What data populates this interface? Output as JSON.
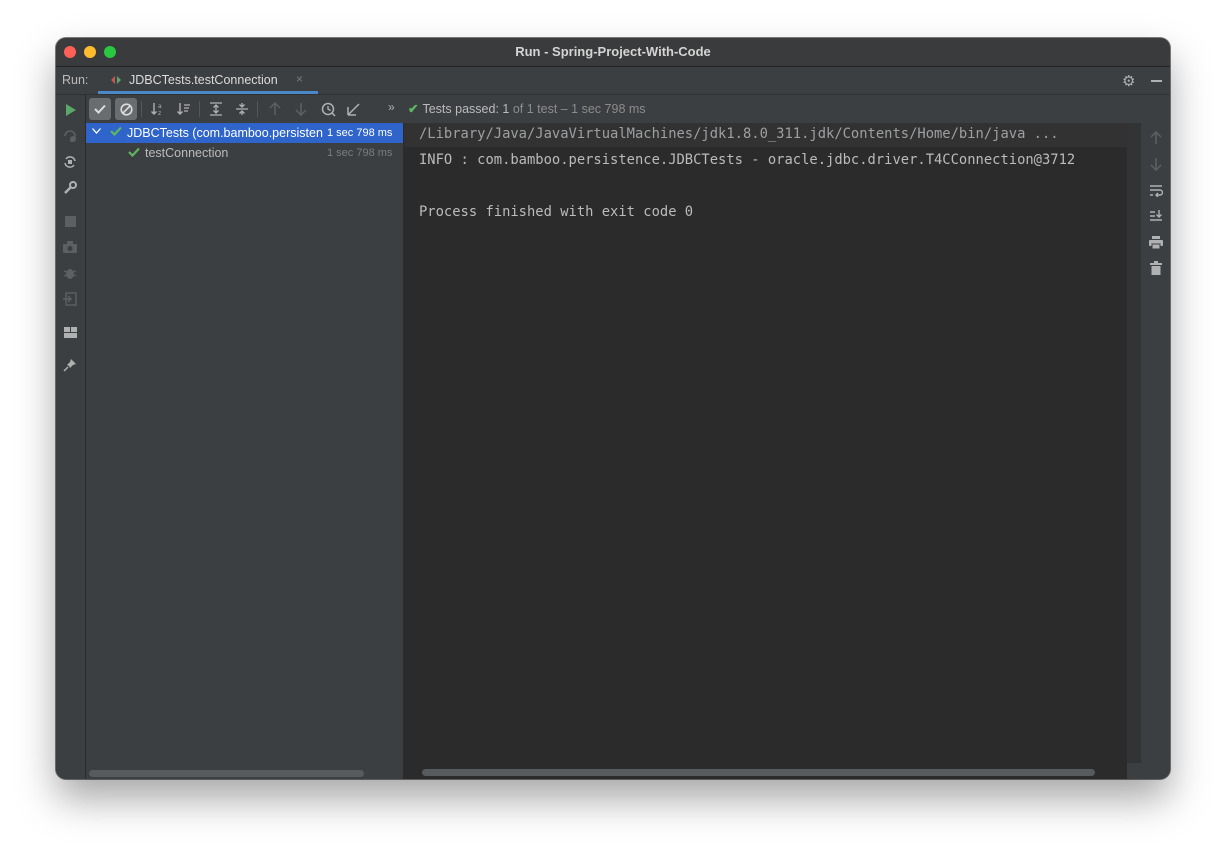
{
  "window": {
    "title": "Run - Spring-Project-With-Code"
  },
  "tabbar": {
    "run_label": "Run:",
    "tab_label": "JDBCTests.testConnection",
    "close_glyph": "×"
  },
  "toolbar": {
    "status_check": "✔",
    "status_prefix": "Tests passed: ",
    "status_count": "1",
    "status_suffix": " of 1 test – 1 sec 798 ms",
    "more_glyph": "»"
  },
  "tree": {
    "items": [
      {
        "name": "JDBCTests (com.bamboo.persistence)",
        "time": "1 sec 798 ms",
        "status": "passed",
        "selected": true
      },
      {
        "name": "testConnection",
        "time": "1 sec 798 ms",
        "status": "passed",
        "selected": false
      }
    ]
  },
  "console": {
    "lines": [
      "/Library/Java/JavaVirtualMachines/jdk1.8.0_311.jdk/Contents/Home/bin/java ...",
      "INFO : com.bamboo.persistence.JDBCTests - oracle.jdbc.driver.T4CConnection@3712",
      "",
      "Process finished with exit code 0"
    ]
  },
  "colors": {
    "accent": "#2f65ca",
    "pass": "#5fb65f",
    "run_green": "#59a869",
    "tab_underline": "#4a88c7"
  },
  "icons": {
    "left_strip": [
      "rerun-icon",
      "rerun-failed-icon",
      "toggle-autotest-icon",
      "wrench-icon",
      "stop-icon",
      "camera-icon",
      "debug-icon",
      "import-icon",
      "layout-icon",
      "pin-icon"
    ],
    "toolbar": [
      "show-passed-icon",
      "show-ignored-icon",
      "sort-alpha-icon",
      "sort-duration-icon",
      "expand-all-icon",
      "collapse-all-icon",
      "previous-test-icon",
      "next-test-icon",
      "history-icon",
      "import-tests-icon"
    ],
    "right_strip": [
      "scroll-up-icon",
      "scroll-down-icon",
      "soft-wrap-icon",
      "scroll-to-end-icon",
      "print-icon",
      "clear-icon"
    ]
  }
}
